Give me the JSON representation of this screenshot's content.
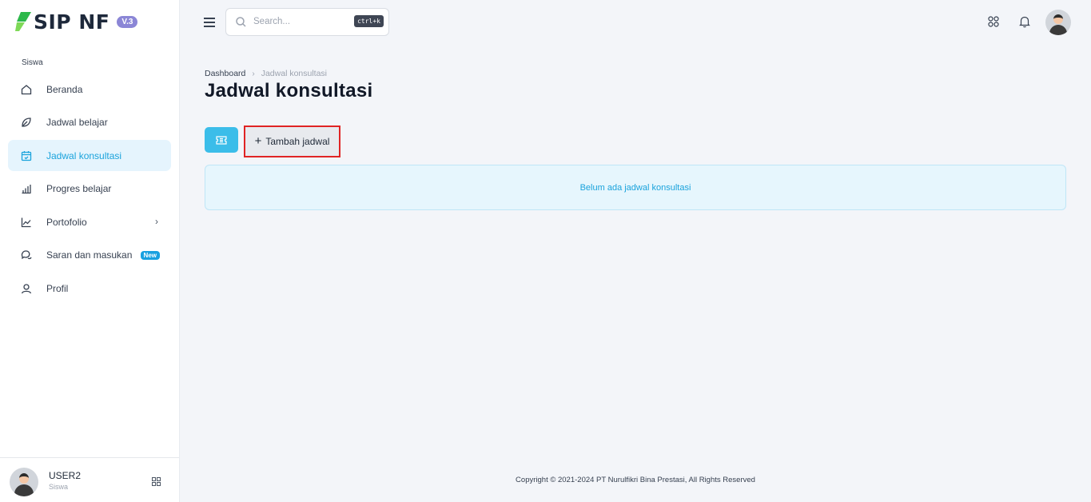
{
  "app": {
    "name": "SIP NF",
    "version": "V.3",
    "brand_color": "#2db84b",
    "accent_color": "#1aa3dc"
  },
  "sidebar": {
    "section": "Siswa",
    "items": [
      {
        "label": "Beranda",
        "icon": "home-icon"
      },
      {
        "label": "Jadwal belajar",
        "icon": "leaf-icon"
      },
      {
        "label": "Jadwal konsultasi",
        "icon": "calendar-check-icon",
        "active": true
      },
      {
        "label": "Progres belajar",
        "icon": "bar-chart-icon"
      },
      {
        "label": "Portofolio",
        "icon": "line-chart-icon",
        "has_submenu": true
      },
      {
        "label": "Saran dan masukan",
        "icon": "chat-icon",
        "badge": "New"
      },
      {
        "label": "Profil",
        "icon": "user-icon"
      }
    ]
  },
  "user": {
    "name": "USER2",
    "role": "Siswa"
  },
  "topbar": {
    "search_placeholder": "Search...",
    "shortcut": "ctrl+k"
  },
  "breadcrumb": {
    "root": "Dashboard",
    "current": "Jadwal konsultasi"
  },
  "page": {
    "title": "Jadwal konsultasi",
    "add_button": "Tambah jadwal",
    "empty_message": "Belum ada jadwal konsultasi"
  },
  "footer": {
    "copyright": "Copyright © 2021-2024 PT Nurulfikri Bina Prestasi, All Rights Reserved"
  }
}
